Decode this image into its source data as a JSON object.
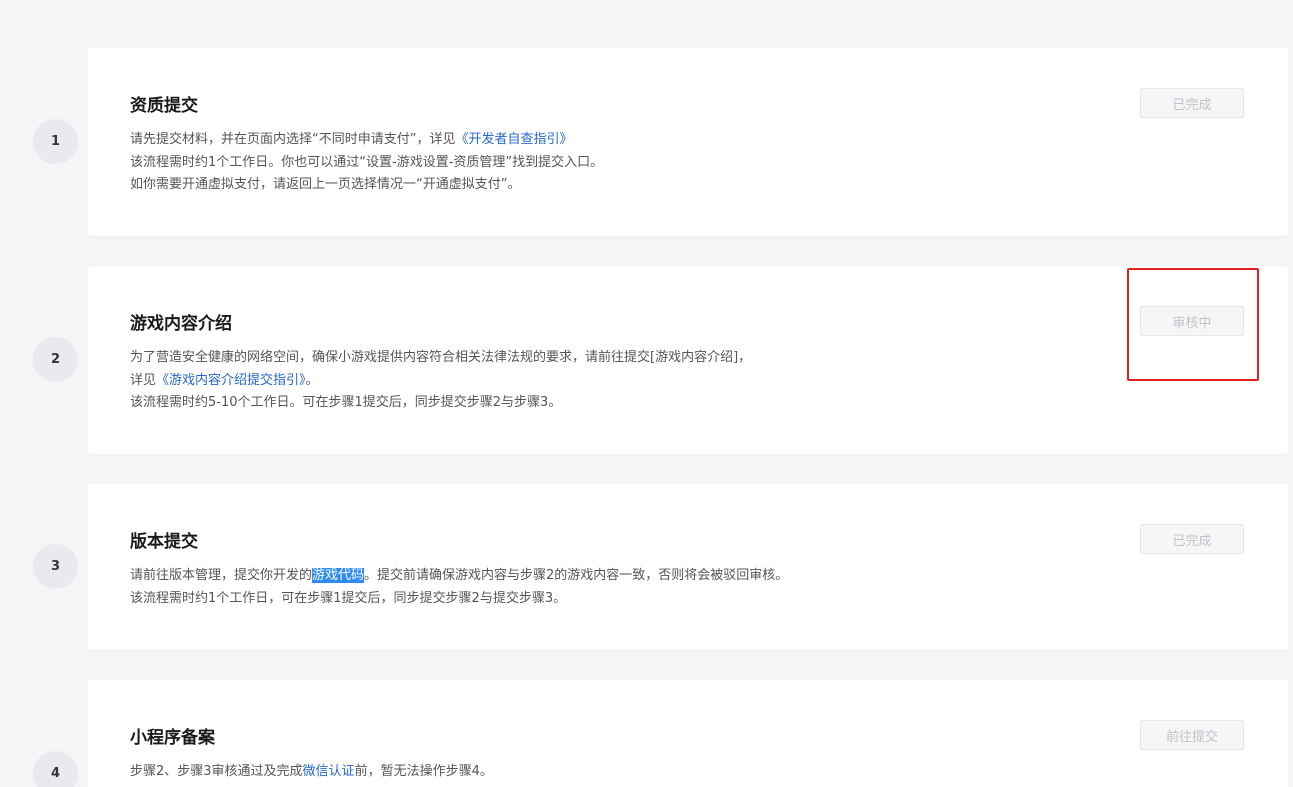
{
  "steps": [
    {
      "number": "1",
      "title": "资质提交",
      "status": "已完成",
      "desc_line1_prefix": "请先提交材料，并在页面内选择“不同时申请支付”，详见",
      "desc_line1_link": "《开发者自查指引》",
      "desc_line2": "该流程需时约1个工作日。你也可以通过“设置-游戏设置-资质管理”找到提交入口。",
      "desc_line3": "如你需要开通虚拟支付，请返回上一页选择情况一“开通虚拟支付”。"
    },
    {
      "number": "2",
      "title": "游戏内容介绍",
      "status": "审核中",
      "desc_line1": "为了营造安全健康的网络空间，确保小游戏提供内容符合相关法律法规的要求，请前往提交[游戏内容介绍]，",
      "desc_line2_prefix": "详见",
      "desc_line2_link": "《游戏内容介绍提交指引》",
      "desc_line2_suffix": "。",
      "desc_line3": "该流程需时约5-10个工作日。可在步骤1提交后，同步提交步骤2与步骤3。"
    },
    {
      "number": "3",
      "title": "版本提交",
      "status": "已完成",
      "desc_line1_prefix": "请前往版本管理，提交你开发的",
      "desc_line1_highlight": "游戏代码",
      "desc_line1_suffix": "。提交前请确保游戏内容与步骤2的游戏内容一致，否则将会被驳回审核。",
      "desc_line2": "该流程需时约1个工作日，可在步骤1提交后，同步提交步骤2与提交步骤3。"
    },
    {
      "number": "4",
      "title": "小程序备案",
      "status": "前往提交",
      "desc_line1_prefix": "步骤2、步骤3审核通过及完成",
      "desc_line1_link": "微信认证",
      "desc_line1_suffix": "前，暂无法操作步骤4。"
    }
  ],
  "colors": {
    "background": "#f4f5f7",
    "link": "#2768c9",
    "highlight": "#2f8cf5",
    "annotation_frame": "#e0211d",
    "disabled_text": "#c1c3c7"
  }
}
